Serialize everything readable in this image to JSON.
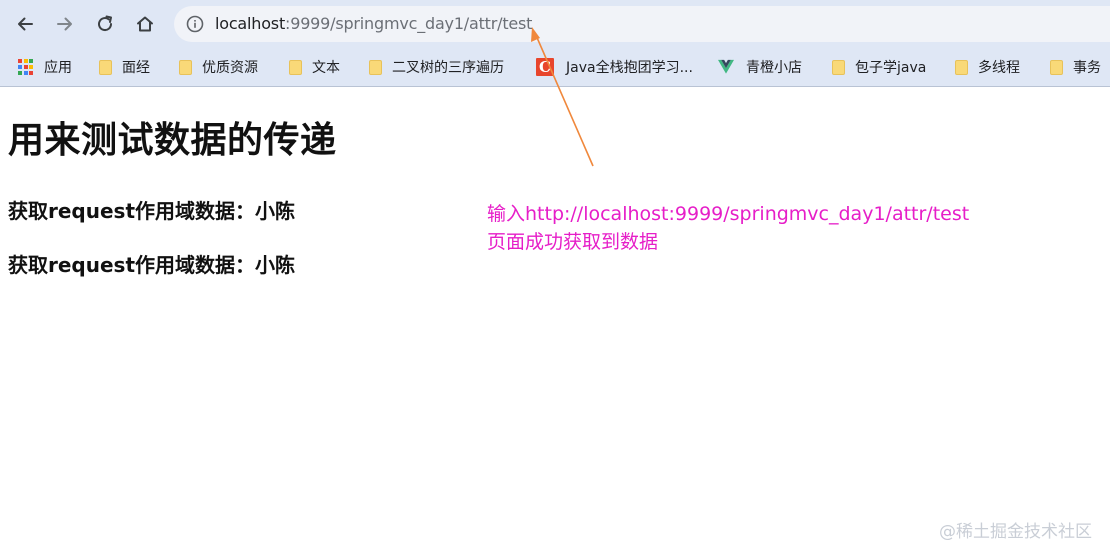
{
  "browser": {
    "url_host": "localhost",
    "url_path": ":9999/springmvc_day1/attr/test",
    "bookmarks": [
      {
        "label": "应用",
        "icon": "apps-grid-icon"
      },
      {
        "label": "面经",
        "icon": "folder-icon"
      },
      {
        "label": "优质资源",
        "icon": "folder-icon"
      },
      {
        "label": "文本",
        "icon": "folder-icon"
      },
      {
        "label": "二叉树的三序遍历",
        "icon": "folder-icon"
      },
      {
        "label": "Java全栈抱团学习...",
        "icon": "c-logo-icon"
      },
      {
        "label": "青橙小店",
        "icon": "vue-logo-icon"
      },
      {
        "label": "包子学java",
        "icon": "folder-icon"
      },
      {
        "label": "多线程",
        "icon": "folder-icon"
      },
      {
        "label": "事务",
        "icon": "folder-icon"
      }
    ]
  },
  "page": {
    "title": "用来测试数据的传递",
    "lines": [
      "获取request作用域数据：小陈",
      "获取request作用域数据：小陈"
    ]
  },
  "annotation": {
    "line1": "输入http://localhost:9999/springmvc_day1/attr/test",
    "line2": "页面成功获取到数据",
    "color": "#e61ec8",
    "arrow_color": "#f0883c"
  },
  "watermark": "@稀土掘金技术社区",
  "colors": {
    "chrome_bg": "#dfe7f5",
    "omnibox_bg": "#f1f3f8",
    "folder": "#f9d978"
  }
}
